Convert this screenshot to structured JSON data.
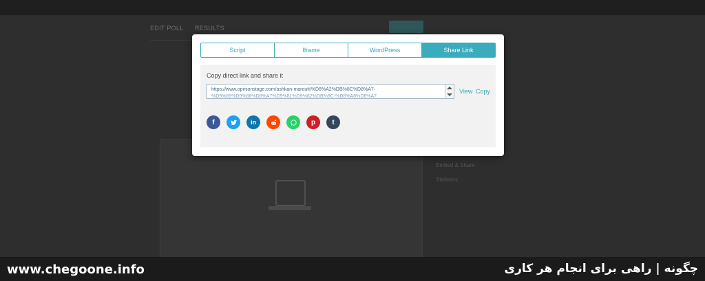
{
  "background": {
    "tabs": [
      "EDIT POLL",
      "RESULTS"
    ],
    "side_items": [
      "Embed & Share",
      "Statistics"
    ]
  },
  "modal": {
    "tabs": [
      {
        "label": "Script",
        "active": false
      },
      {
        "label": "Iframe",
        "active": false
      },
      {
        "label": "WordPress",
        "active": false
      },
      {
        "label": "Share Link",
        "active": true
      }
    ],
    "description": "Copy direct link and share it",
    "link_line1": "https://www.opinionstage.com/ashkan-maroufi/%D8%A2%DB%8C%D8%A7-",
    "link_line2": "%D9%85%D9%88%D8%A7%D9%81%D9%82%DB%8C-%D8%A8%D8%A7",
    "view_label": "View",
    "copy_label": "Copy",
    "social": [
      {
        "name": "facebook",
        "letter": "f",
        "color": "#3b5998"
      },
      {
        "name": "twitter",
        "letter": "t",
        "color": "#1da1f2"
      },
      {
        "name": "linkedin",
        "letter": "in",
        "color": "#0e76a8"
      },
      {
        "name": "reddit",
        "letter": "r",
        "color": "#ff4500"
      },
      {
        "name": "whatsapp",
        "letter": "w",
        "color": "#25d366"
      },
      {
        "name": "pinterest",
        "letter": "p",
        "color": "#cb2027"
      },
      {
        "name": "tumblr",
        "letter": "t",
        "color": "#35465c"
      }
    ]
  },
  "footer": {
    "website": "www.chegoone.info",
    "tagline": "چگونه | راهی برای انجام هر کاری"
  }
}
